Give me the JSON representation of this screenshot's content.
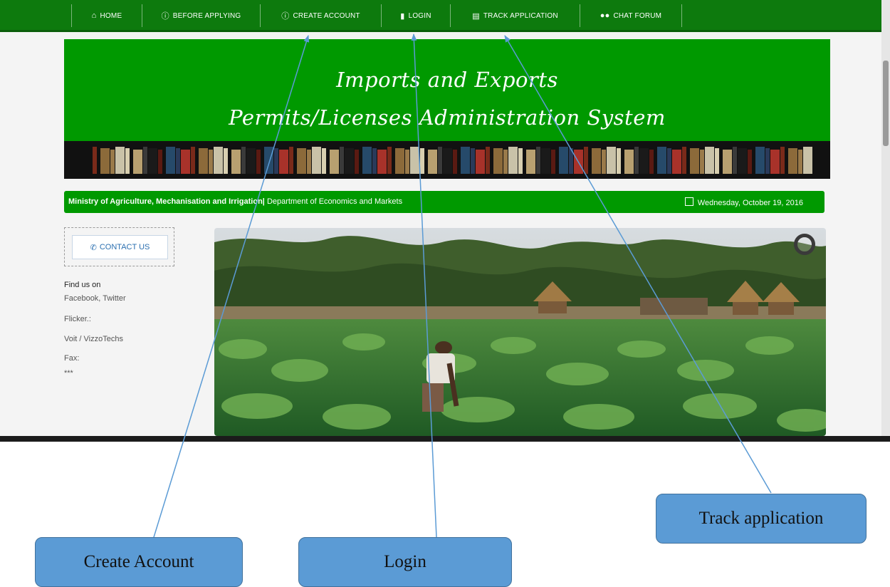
{
  "nav": {
    "items": [
      {
        "label": "HOME",
        "icon": "home-icon"
      },
      {
        "label": "BEFORE APPLYING",
        "icon": "info-icon"
      },
      {
        "label": "CREATE ACCOUNT",
        "icon": "info-icon"
      },
      {
        "label": "LOGIN",
        "icon": "document-icon"
      },
      {
        "label": "TRACK APPLICATION",
        "icon": "book-icon"
      },
      {
        "label": "CHAT FORUM",
        "icon": "users-icon"
      }
    ]
  },
  "banner": {
    "line1": "Imports and Exports",
    "line2": "Permits/Licenses Administration System"
  },
  "ministry": {
    "name": "Ministry of Agriculture, Mechanisation and Irrigation",
    "separator": "|",
    "department": "Department of Economics and Markets",
    "date": "Wednesday, October 19, 2016"
  },
  "sidebar": {
    "contact_label": "CONTACT US",
    "find_us_heading": "Find us on",
    "social": "Facebook, Twitter",
    "flicker": "Flicker.:",
    "voit": "Voit / VizzoTechs",
    "fax": "Fax:",
    "fax_value": "***"
  },
  "callouts": {
    "create_account": "Create Account",
    "login": "Login",
    "track_application": "Track application"
  },
  "colors": {
    "nav_green": "#0d7a0d",
    "banner_green": "#009900",
    "callout_blue": "#5b9bd5",
    "arrow_blue": "#5b9bd5"
  }
}
